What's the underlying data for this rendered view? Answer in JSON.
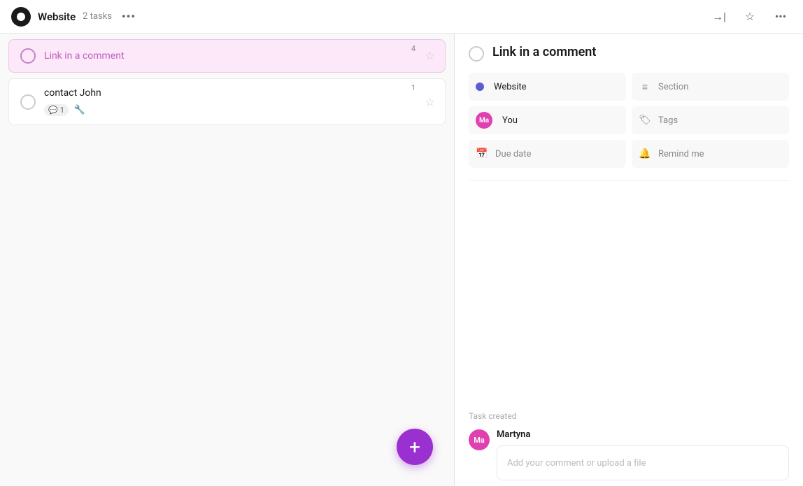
{
  "header": {
    "project_icon_label": "project-icon",
    "project_title": "Website",
    "task_count": "2 tasks",
    "more_dots": "•••",
    "nav_arrow": "→|",
    "star_icon": "☆",
    "more_icon": "•••"
  },
  "task_list": {
    "tasks": [
      {
        "id": 1,
        "title": "Link in a comment",
        "badge": "4",
        "is_active": true,
        "meta": null
      },
      {
        "id": 2,
        "title": "contact John",
        "badge": "1",
        "is_active": false,
        "meta": {
          "comment_count": "1",
          "has_wrench": true
        }
      }
    ],
    "add_button_label": "+"
  },
  "task_detail": {
    "nav_icon": "→|",
    "star_icon": "☆",
    "more_icon": "•••",
    "title": "Link in a comment",
    "fields": {
      "project_label": "Website",
      "section_label": "Section",
      "assignee_label": "You",
      "tags_label": "Tags",
      "due_date_label": "Due date",
      "remind_me_label": "Remind me"
    },
    "comment_section": {
      "task_created_label": "Task created",
      "user_name": "Martyna",
      "user_initials": "Ma",
      "input_placeholder": "Add your comment or upload a file"
    }
  }
}
